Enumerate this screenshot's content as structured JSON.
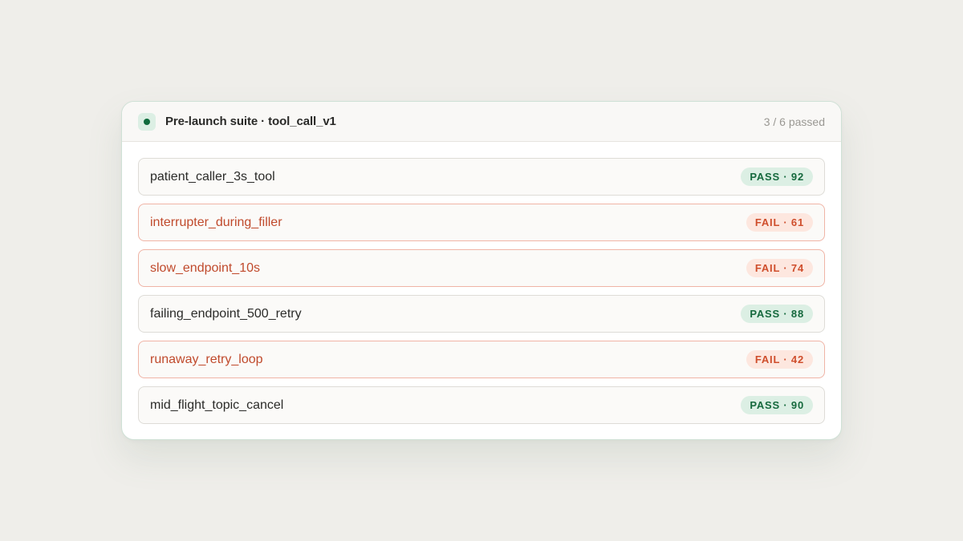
{
  "suite": {
    "title": "Pre-launch suite · tool_call_v1",
    "summary": "3 / 6 passed",
    "status_icon": "status-dot-icon"
  },
  "colors": {
    "pass_text": "#15693d",
    "pass_bg": "#dcefe4",
    "fail_text": "#cf4e2c",
    "fail_bg": "#fde7df",
    "fail_border": "#f0b4a6"
  },
  "tests": [
    {
      "name": "patient_caller_3s_tool",
      "status": "pass",
      "badge": "PASS · 92",
      "score": 92
    },
    {
      "name": "interrupter_during_filler",
      "status": "fail",
      "badge": "FAIL · 61",
      "score": 61
    },
    {
      "name": "slow_endpoint_10s",
      "status": "fail",
      "badge": "FAIL · 74",
      "score": 74
    },
    {
      "name": "failing_endpoint_500_retry",
      "status": "pass",
      "badge": "PASS · 88",
      "score": 88
    },
    {
      "name": "runaway_retry_loop",
      "status": "fail",
      "badge": "FAIL · 42",
      "score": 42
    },
    {
      "name": "mid_flight_topic_cancel",
      "status": "pass",
      "badge": "PASS · 90",
      "score": 90
    }
  ]
}
